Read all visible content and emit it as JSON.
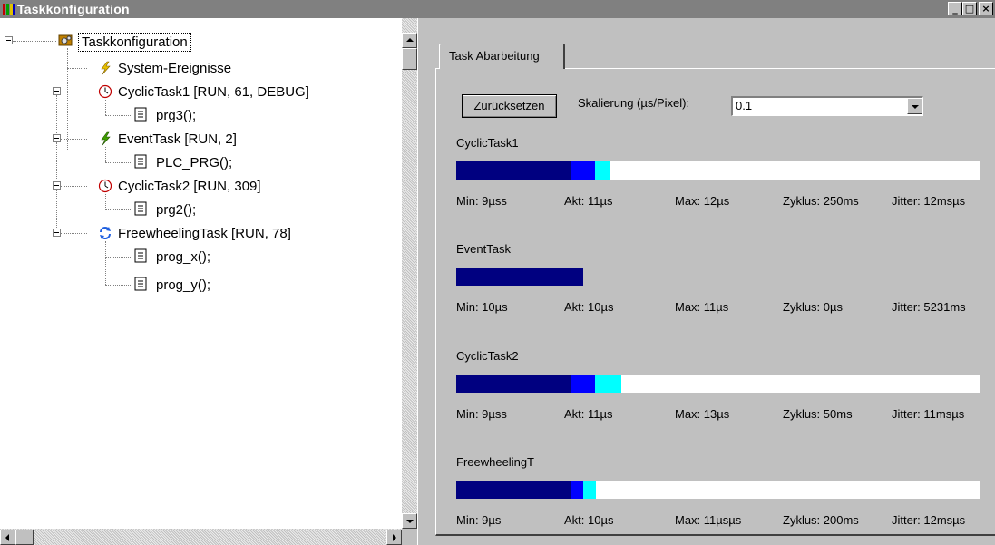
{
  "window": {
    "title": "Taskkonfiguration",
    "buttons": {
      "minimize": "_",
      "maximize": "□",
      "close": "×"
    }
  },
  "tree": {
    "root": "Taskkonfiguration",
    "items": [
      {
        "label": "System-Ereignisse",
        "icon": "lightning-icon"
      },
      {
        "label": "CyclicTask1 [RUN, 61, DEBUG]",
        "icon": "clock-icon",
        "children": [
          "prg3();"
        ]
      },
      {
        "label": "EventTask [RUN, 2]",
        "icon": "lightning-icon",
        "children": [
          "PLC_PRG();"
        ]
      },
      {
        "label": "CyclicTask2 [RUN, 309]",
        "icon": "clock-icon",
        "children": [
          "prg2();"
        ]
      },
      {
        "label": "FreewheelingTask [RUN, 78]",
        "icon": "cycle-arrows-icon",
        "children": [
          "prog_x();",
          "prog_y();"
        ]
      }
    ]
  },
  "panel": {
    "tab_label": "Task Abarbeitung",
    "reset_button": "Zurücksetzen",
    "scale_label": "Skalierung (µs/Pixel):",
    "scale_value": "0.1"
  },
  "tasks": [
    {
      "name": "CyclicTask1",
      "min": "Min: 9µss",
      "akt": "Akt: 11µs",
      "max": "Max: 12µs",
      "zyklus": "Zyklus: 250ms",
      "jitter": "Jitter: 12msµs",
      "bar_min_us": 12.6,
      "bar_akt_us": 15.3,
      "bar_max_us": 16.9
    },
    {
      "name": "EventTask",
      "min": "Min: 10µs",
      "akt": "Akt: 10µs",
      "max": "Max: 11µs",
      "zyklus": "Zyklus: 0µs",
      "jitter": "Jitter: 5231ms",
      "bar_min_us": 14.0,
      "bar_akt_us": 14.0,
      "bar_max_us": 14.0
    },
    {
      "name": "CyclicTask2",
      "min": "Min: 9µss",
      "akt": "Akt: 11µs",
      "max": "Max: 13µs",
      "zyklus": "Zyklus: 50ms",
      "jitter": "Jitter: 11msµs",
      "bar_min_us": 12.6,
      "bar_akt_us": 15.3,
      "bar_max_us": 18.2
    },
    {
      "name": "FreewheelingT",
      "min": "Min: 9µs",
      "akt": "Akt: 10µs",
      "max": "Max: 11µsµs",
      "zyklus": "Zyklus: 200ms",
      "jitter": "Jitter: 12msµs",
      "bar_min_us": 12.6,
      "bar_akt_us": 14.0,
      "bar_max_us": 15.4
    }
  ],
  "colors": {
    "title_bar": "#808080",
    "bar_min": "#000080",
    "bar_akt": "#0000ff",
    "bar_max": "#00ffff",
    "bar_track": "#ffffff"
  }
}
